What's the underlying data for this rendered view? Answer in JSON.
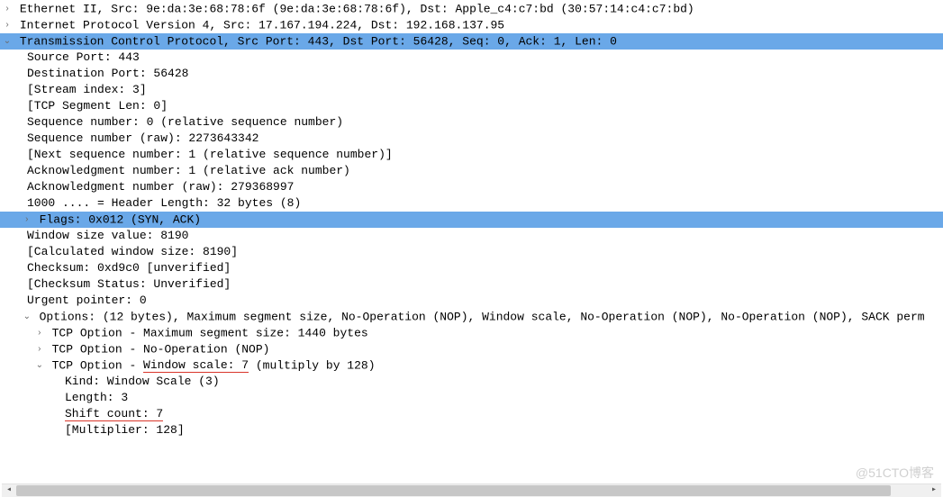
{
  "eth": "Ethernet II, Src: 9e:da:3e:68:78:6f (9e:da:3e:68:78:6f), Dst: Apple_c4:c7:bd (30:57:14:c4:c7:bd)",
  "ip": "Internet Protocol Version 4, Src: 17.167.194.224, Dst: 192.168.137.95",
  "tcp": {
    "summary": "Transmission Control Protocol, Src Port: 443, Dst Port: 56428, Seq: 0, Ack: 1, Len: 0",
    "src_port": "Source Port: 443",
    "dst_port": "Destination Port: 56428",
    "stream": "[Stream index: 3]",
    "seglen": "[TCP Segment Len: 0]",
    "seq_rel": "Sequence number: 0    (relative sequence number)",
    "seq_raw": "Sequence number (raw): 2273643342",
    "next_seq": "[Next sequence number: 1    (relative sequence number)]",
    "ack_rel": "Acknowledgment number: 1    (relative ack number)",
    "ack_raw": "Acknowledgment number (raw): 279368997",
    "hdr_len": "1000 .... = Header Length: 32 bytes (8)",
    "flags": "Flags: 0x012 (SYN, ACK)",
    "win": "Window size value: 8190",
    "calc_win": "[Calculated window size: 8190]",
    "cksum": "Checksum: 0xd9c0 [unverified]",
    "cksum_stat": "[Checksum Status: Unverified]",
    "urg": "Urgent pointer: 0",
    "options": "Options: (12 bytes), Maximum segment size, No-Operation (NOP), Window scale, No-Operation (NOP), No-Operation (NOP), SACK perm",
    "opt_mss": "TCP Option - Maximum segment size: 1440 bytes",
    "opt_nop": "TCP Option - No-Operation (NOP)",
    "opt_ws_prefix": "TCP Option - ",
    "opt_ws_underlined": "Window scale: 7",
    "opt_ws_suffix": " (multiply by 128)",
    "ws_kind": "Kind: Window Scale (3)",
    "ws_len": "Length: 3",
    "ws_shift": "Shift count: 7",
    "ws_mult": "[Multiplier: 128]"
  },
  "watermark": "@51CTO博客"
}
